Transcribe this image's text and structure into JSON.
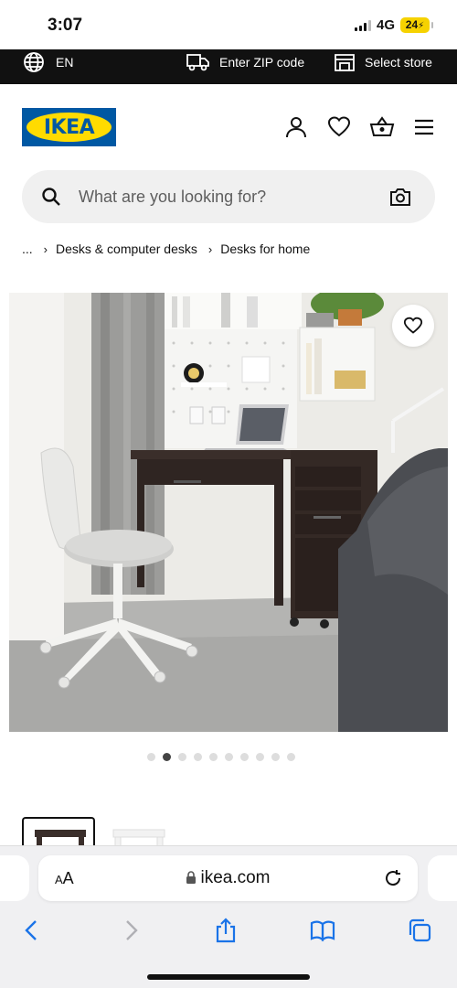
{
  "status": {
    "time": "3:07",
    "network": "4G",
    "battery": "24"
  },
  "top_strip": {
    "language": "EN",
    "zip": "Enter ZIP code",
    "store": "Select store"
  },
  "header": {
    "logo": "IKEA"
  },
  "search": {
    "placeholder": "What are you looking for?"
  },
  "breadcrumb": {
    "ellipsis": "...",
    "items": [
      "Desks & computer desks",
      "Desks for home"
    ]
  },
  "gallery": {
    "dot_count": 10,
    "active_index": 1
  },
  "browser": {
    "aa": "A",
    "aa_small": "A",
    "url": "ikea.com"
  },
  "colors": {
    "ikea_blue": "#0058a3",
    "ikea_yellow": "#ffdb00",
    "battery": "#f6d200",
    "ios_blue": "#1a73e8"
  }
}
